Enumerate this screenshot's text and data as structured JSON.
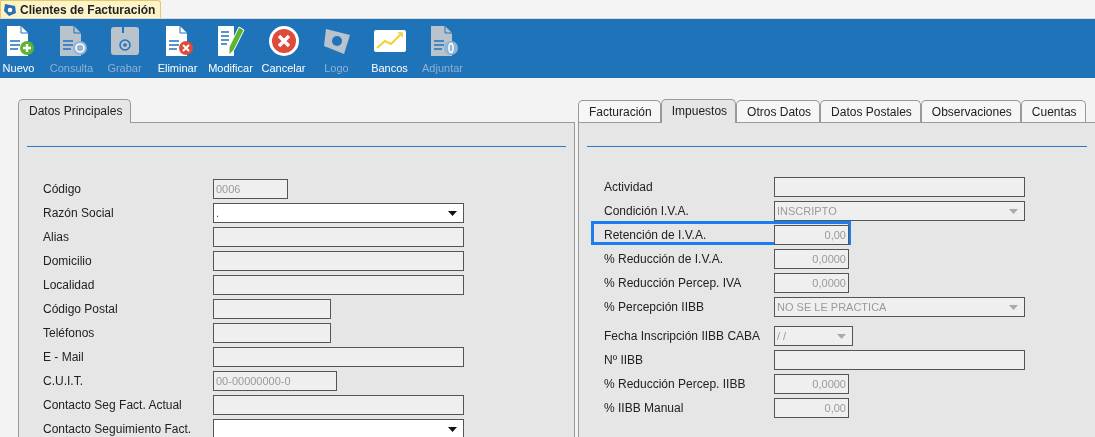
{
  "window": {
    "title": "Clientes de Facturación"
  },
  "toolbar": [
    {
      "label": "Nuevo",
      "disabled": false
    },
    {
      "label": "Consulta",
      "disabled": true
    },
    {
      "label": "Grabar",
      "disabled": true
    },
    {
      "label": "Eliminar",
      "disabled": false
    },
    {
      "label": "Modificar",
      "disabled": false
    },
    {
      "label": "Cancelar",
      "disabled": false
    },
    {
      "label": "Logo",
      "disabled": true
    },
    {
      "label": "Bancos",
      "disabled": false
    },
    {
      "label": "Adjuntar",
      "disabled": true
    }
  ],
  "left_panel": {
    "tabs": [
      {
        "label": "Datos Principales",
        "selected": true
      }
    ],
    "fields": [
      {
        "label": "Código",
        "kind": "text",
        "value": "0006",
        "disabled": true
      },
      {
        "label": "Razón Social",
        "kind": "combo",
        "value": ".",
        "disabled": false
      },
      {
        "label": "Alias",
        "kind": "text",
        "disabled": true
      },
      {
        "label": "Domicilio",
        "kind": "text",
        "disabled": true
      },
      {
        "label": "Localidad",
        "kind": "text",
        "disabled": true
      },
      {
        "label": "Código Postal",
        "kind": "text",
        "disabled": true
      },
      {
        "label": "Teléfonos",
        "kind": "text",
        "disabled": true
      },
      {
        "label": "E - Mail",
        "kind": "text",
        "disabled": true
      },
      {
        "label": "C.U.I.T.",
        "kind": "text",
        "value": "00-00000000-0",
        "disabled": true
      },
      {
        "label": "Contacto Seg Fact. Actual",
        "kind": "text",
        "disabled": true
      },
      {
        "label": "Contacto Seguimiento Fact.",
        "kind": "combo",
        "disabled": false
      }
    ]
  },
  "right_panel": {
    "tabs": [
      {
        "label": "Facturación",
        "selected": false
      },
      {
        "label": "Impuestos",
        "selected": true
      },
      {
        "label": "Otros Datos",
        "selected": false
      },
      {
        "label": "Datos Postales",
        "selected": false
      },
      {
        "label": "Observaciones",
        "selected": false
      },
      {
        "label": "Cuentas",
        "selected": false
      }
    ],
    "fields": [
      {
        "label": "Actividad",
        "kind": "text",
        "disabled": true,
        "highlighted": false
      },
      {
        "label": "Condición I.V.A.",
        "kind": "combo",
        "value": "INSCRIPTO",
        "disabled": true,
        "highlighted": false
      },
      {
        "label": "Retención de I.V.A.",
        "kind": "number",
        "value": "0,00",
        "disabled": true,
        "highlighted": true
      },
      {
        "label": "% Reducción de I.V.A.",
        "kind": "number",
        "value": "0,0000",
        "disabled": true,
        "highlighted": false
      },
      {
        "label": "% Reducción Percep. IVA",
        "kind": "number",
        "value": "0,0000",
        "disabled": true,
        "highlighted": false
      },
      {
        "label": "% Percepción IIBB",
        "kind": "combo",
        "value": "NO SE LE PRACTICA",
        "disabled": true,
        "highlighted": false
      },
      {
        "label": "Fecha Inscripción IIBB CABA",
        "kind": "combo",
        "value": "/  /",
        "disabled": true,
        "highlighted": false
      },
      {
        "label": "Nº IIBB",
        "kind": "text",
        "disabled": true,
        "highlighted": false
      },
      {
        "label": "% Reducción Percep. IIBB",
        "kind": "number",
        "value": "0,0000",
        "disabled": true,
        "highlighted": false
      },
      {
        "label": "% IIBB Manual",
        "kind": "number",
        "value": "0,00",
        "disabled": true,
        "highlighted": false
      }
    ]
  }
}
